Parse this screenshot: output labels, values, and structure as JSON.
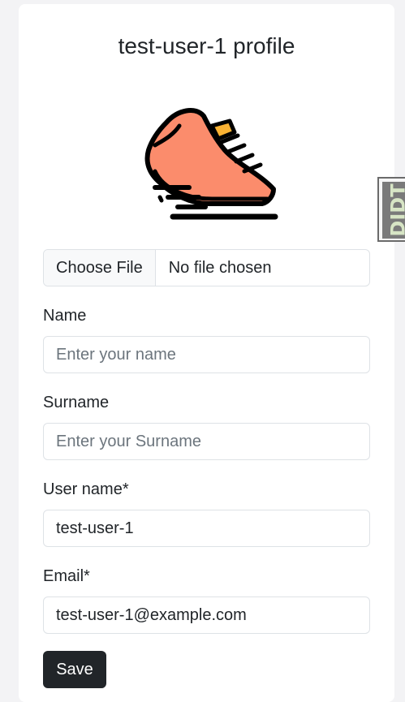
{
  "profile": {
    "title": "test-user-1 profile"
  },
  "avatar": {
    "icon": "running-shoe-icon",
    "colors": {
      "body": "#fb8c6c",
      "accent": "#f9b233",
      "outline": "#000000"
    }
  },
  "file_input": {
    "button_label": "Choose File",
    "status": "No file chosen"
  },
  "form": {
    "name": {
      "label": "Name",
      "value": "",
      "placeholder": "Enter your name"
    },
    "surname": {
      "label": "Surname",
      "value": "",
      "placeholder": "Enter your Surname"
    },
    "username": {
      "label": "User name*",
      "value": "test-user-1",
      "placeholder": ""
    },
    "email": {
      "label": "Email*",
      "value": "test-user-1@example.com",
      "placeholder": ""
    },
    "save_label": "Save"
  },
  "side_widget": {
    "text": "DIDT"
  },
  "colors": {
    "button_dark": "#212529",
    "border": "#dee2e6",
    "background": "#f3f3f5"
  }
}
